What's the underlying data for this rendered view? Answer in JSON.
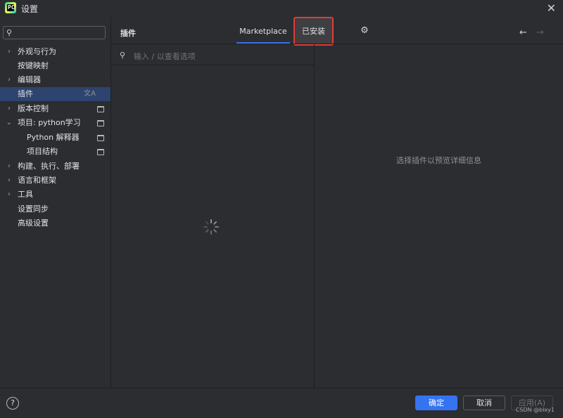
{
  "window": {
    "title": "设置",
    "close_glyph": "✕"
  },
  "sidebar": {
    "search_placeholder": "",
    "items": [
      {
        "label": "外观与行为",
        "chevron": "›"
      },
      {
        "label": "按键映射",
        "chevron": ""
      },
      {
        "label": "编辑器",
        "chevron": "›"
      },
      {
        "label": "插件",
        "chevron": "",
        "selected": true,
        "badge": "文A"
      },
      {
        "label": "版本控制",
        "chevron": "›",
        "icon": "project-scope-icon"
      },
      {
        "label": "项目: python学习",
        "chevron": "⌄",
        "icon": "project-scope-icon"
      },
      {
        "label": "Python 解释器",
        "chevron": "",
        "icon": "project-scope-icon"
      },
      {
        "label": "项目结构",
        "chevron": "",
        "icon": "project-scope-icon"
      },
      {
        "label": "构建、执行、部署",
        "chevron": "›"
      },
      {
        "label": "语言和框架",
        "chevron": "›"
      },
      {
        "label": "工具",
        "chevron": "›"
      },
      {
        "label": "设置同步",
        "chevron": ""
      },
      {
        "label": "高级设置",
        "chevron": ""
      }
    ]
  },
  "content": {
    "title": "插件",
    "tabs": [
      {
        "label": "Marketplace",
        "active": true
      },
      {
        "label": "已安装",
        "highlighted": true
      }
    ],
    "gear_glyph": "⚙",
    "nav_back": "←",
    "nav_forward": "→",
    "plugin_search_placeholder": "输入 / 以查看选项",
    "detail_hint": "选择插件以预览详细信息"
  },
  "footer": {
    "help": "?",
    "ok": "确定",
    "cancel": "取消",
    "apply": "应用(A)",
    "watermark": "CSDN @blxy1"
  },
  "colors": {
    "accent": "#3574f0",
    "selection": "#2e436e",
    "highlight_box": "#e53935",
    "background": "#2b2d30"
  }
}
